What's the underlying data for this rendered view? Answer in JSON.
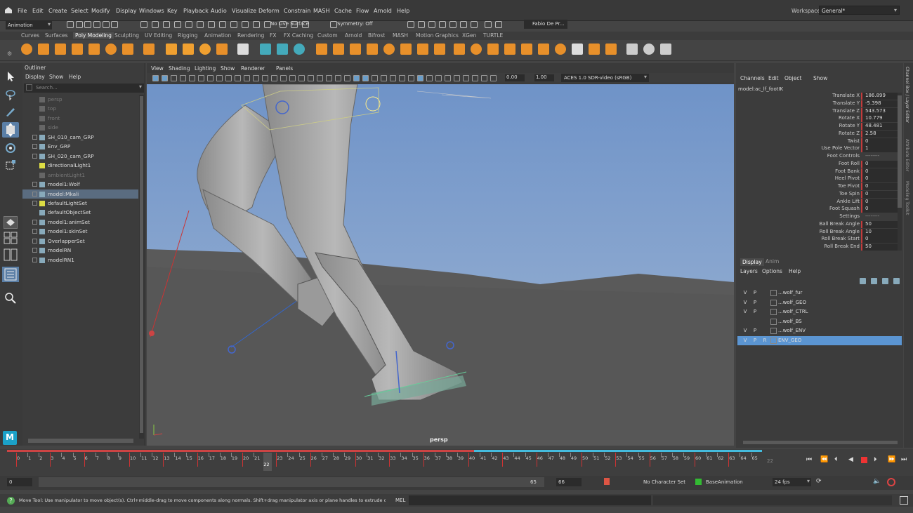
{
  "menubar": {
    "items": [
      "File",
      "Edit",
      "Create",
      "Select",
      "Modify",
      "Display",
      "Windows",
      "Key",
      "Playback",
      "Audio",
      "Visualize",
      "Deform",
      "Constrain",
      "MASH",
      "Cache",
      "Flow",
      "Arnold",
      "Help"
    ],
    "workspace_label": "Workspace:",
    "workspace_value": "General*"
  },
  "statusline": {
    "menuset": "Animation",
    "live_surface": "No Live Surface",
    "symmetry": "Symmetry: Off",
    "user": "Fabio De Pr..."
  },
  "shelf": {
    "tabs": [
      "Curves",
      "Surfaces",
      "Poly Modeling",
      "Sculpting",
      "UV Editing",
      "Rigging",
      "Animation",
      "Rendering",
      "FX",
      "FX Caching",
      "Custom",
      "Arnold",
      "Bifrost",
      "MASH",
      "Motion Graphics",
      "XGen",
      "TURTLE"
    ],
    "active_tab": "Poly Modeling"
  },
  "outliner": {
    "title": "Outliner",
    "menu": [
      "Display",
      "Show",
      "Help"
    ],
    "search_placeholder": "Search...",
    "items": [
      {
        "label": "persp",
        "dim": true,
        "expand": false
      },
      {
        "label": "top",
        "dim": true,
        "expand": false
      },
      {
        "label": "front",
        "dim": true,
        "expand": false
      },
      {
        "label": "side",
        "dim": true,
        "expand": false
      },
      {
        "label": "SH_010_cam_GRP",
        "dim": false,
        "expand": true
      },
      {
        "label": "Env_GRP",
        "dim": false,
        "expand": true
      },
      {
        "label": "SH_020_cam_GRP",
        "dim": false,
        "expand": true
      },
      {
        "label": "directionalLight1",
        "dim": false,
        "expand": false
      },
      {
        "label": "ambientLight1",
        "dim": true,
        "expand": false
      },
      {
        "label": "model1:Wolf",
        "dim": false,
        "expand": true
      },
      {
        "label": "model:Mkali",
        "dim": false,
        "expand": true,
        "selected": true
      },
      {
        "label": "defaultLightSet",
        "dim": false,
        "expand": true
      },
      {
        "label": "defaultObjectSet",
        "dim": false,
        "expand": false
      },
      {
        "label": "model1:animSet",
        "dim": false,
        "expand": true
      },
      {
        "label": "model1:skinSet",
        "dim": false,
        "expand": true
      },
      {
        "label": "OverlapperSet",
        "dim": false,
        "expand": true
      },
      {
        "label": "modelRN",
        "dim": false,
        "expand": true
      },
      {
        "label": "modelRN1",
        "dim": false,
        "expand": true
      }
    ]
  },
  "viewport": {
    "menu": [
      "View",
      "Shading",
      "Lighting",
      "Show",
      "Renderer",
      "Panels"
    ],
    "exposure": "0.00",
    "gamma": "1.00",
    "colorspace": "ACES 1.0 SDR-video (sRGB)",
    "camera_label": "persp"
  },
  "channelbox": {
    "tabs": [
      "Channels",
      "Edit",
      "Object",
      "Show"
    ],
    "node": "model:ac_lf_footIK",
    "channels": [
      {
        "name": "Translate X",
        "value": "186.899",
        "key": true
      },
      {
        "name": "Translate Y",
        "value": "-5.398",
        "key": true
      },
      {
        "name": "Translate Z",
        "value": "543.573",
        "key": true
      },
      {
        "name": "Rotate X",
        "value": "10.779",
        "key": true
      },
      {
        "name": "Rotate Y",
        "value": "48.481",
        "key": true
      },
      {
        "name": "Rotate Z",
        "value": "2.58",
        "key": true
      },
      {
        "name": "Twist",
        "value": "0",
        "key": true
      },
      {
        "name": "Use Pole Vector",
        "value": "1",
        "key": true
      },
      {
        "name": "Foot Controls",
        "value": "--------",
        "key": false
      },
      {
        "name": "Foot Roll",
        "value": "0",
        "key": true
      },
      {
        "name": "Foot Bank",
        "value": "0",
        "key": true
      },
      {
        "name": "Heel Pivot",
        "value": "0",
        "key": true
      },
      {
        "name": "Toe Pivot",
        "value": "0",
        "key": true
      },
      {
        "name": "Toe Spin",
        "value": "0",
        "key": true
      },
      {
        "name": "Ankle Lift",
        "value": "0",
        "key": true
      },
      {
        "name": "Foot Squash",
        "value": "0",
        "key": true
      },
      {
        "name": "Settings",
        "value": "--------",
        "key": false
      },
      {
        "name": "Ball Break Angle",
        "value": "50",
        "key": true
      },
      {
        "name": "Roll Break Angle",
        "value": "10",
        "key": true
      },
      {
        "name": "Roll Break Start",
        "value": "0",
        "key": true
      },
      {
        "name": "Roll Break End",
        "value": "50",
        "key": true
      }
    ]
  },
  "layers": {
    "tabs": [
      "Display",
      "Anim"
    ],
    "menu": [
      "Layers",
      "Options",
      "Help"
    ],
    "rows": [
      {
        "v": "V",
        "p": "P",
        "r": "",
        "name": "...wolf_fur",
        "selected": false
      },
      {
        "v": "V",
        "p": "P",
        "r": "",
        "name": "...wolf_GEO",
        "selected": false
      },
      {
        "v": "V",
        "p": "P",
        "r": "",
        "name": "...wolf_CTRL",
        "selected": false
      },
      {
        "v": "",
        "p": "",
        "r": "",
        "name": "...wolf_BS",
        "selected": false
      },
      {
        "v": "V",
        "p": "P",
        "r": "",
        "name": "...wolf_ENV",
        "selected": false
      },
      {
        "v": "V",
        "p": "P",
        "r": "R",
        "name": "ENV_GEO",
        "selected": true
      }
    ]
  },
  "rightstrip": {
    "labels": [
      "Channel Box / Layer Editor",
      "Attribute Editor",
      "Modeling Toolkit"
    ]
  },
  "timeline": {
    "ticks": [
      "0",
      "1",
      "2",
      "3",
      "4",
      "5",
      "6",
      "7",
      "8",
      "9",
      "10",
      "11",
      "12",
      "13",
      "14",
      "15",
      "16",
      "17",
      "18",
      "19",
      "20",
      "21",
      "22",
      "23",
      "24",
      "25",
      "26",
      "27",
      "28",
      "29",
      "30",
      "31",
      "32",
      "33",
      "34",
      "35",
      "36",
      "37",
      "38",
      "39",
      "40",
      "41",
      "42",
      "43",
      "44",
      "45",
      "46",
      "47",
      "48",
      "49",
      "50",
      "51",
      "52",
      "53",
      "54",
      "55",
      "56",
      "57",
      "58",
      "59",
      "60",
      "61",
      "62",
      "63",
      "64",
      "65"
    ],
    "current_frame": "22",
    "current_frame_field": "22",
    "keys": [
      0,
      3,
      6,
      10,
      13,
      16,
      20,
      23,
      26,
      30,
      33,
      36,
      40,
      43,
      46,
      50,
      53,
      56,
      60,
      63
    ]
  },
  "range": {
    "start": "0",
    "inner_start": "0",
    "inner_end": "65",
    "end": "66",
    "char_set": "No Character Set",
    "anim_layer": "BaseAnimation",
    "fps": "24 fps"
  },
  "cmdline": {
    "help": "Move Tool: Use manipulator to move object(s). Ctrl+middle-drag to move components along normals. Shift+drag manipulator axis or plane handles to extrude components or...",
    "lang": "MEL"
  }
}
